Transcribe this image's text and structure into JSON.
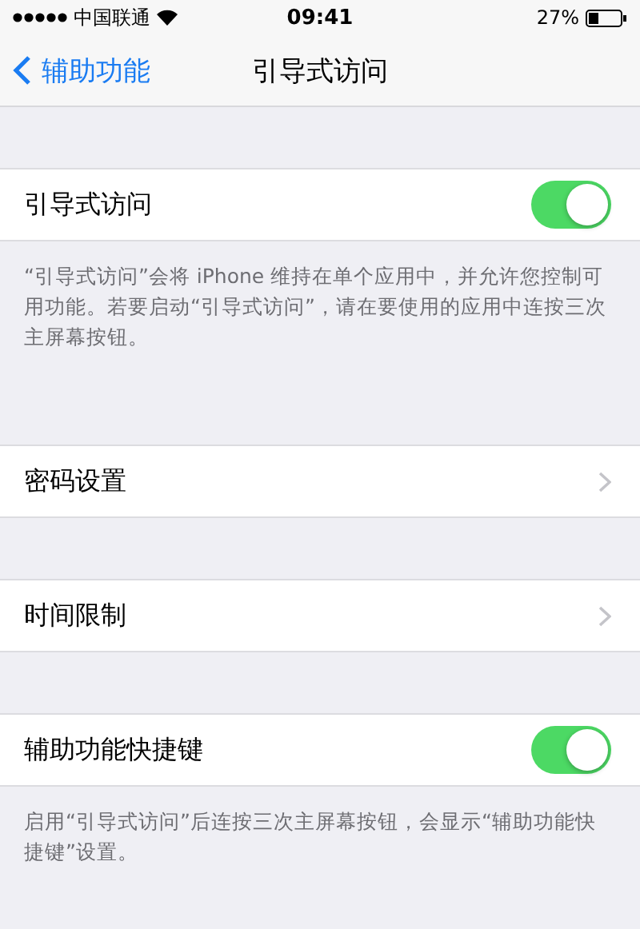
{
  "status_bar": {
    "carrier": "中国联通",
    "time": "09:41",
    "battery": "27%"
  },
  "nav": {
    "back": "辅助功能",
    "title": "引导式访问"
  },
  "sections": [
    {
      "kind": "toggle",
      "label": "引导式访问",
      "on": true,
      "footer": "“引导式访问”会将 iPhone 维持在单个应用中，并允许您控制可用功能。若要启动“引导式访问”，请在要使用的应用中连按三次主屏幕按钮。"
    },
    {
      "kind": "link",
      "label": "密码设置"
    },
    {
      "kind": "link",
      "label": "时间限制"
    },
    {
      "kind": "toggle",
      "label": "辅助功能快捷键",
      "on": true,
      "footer": "启用“引导式访问”后连按三次主屏幕按钮，会显示“辅助功能快捷键”设置。"
    }
  ]
}
